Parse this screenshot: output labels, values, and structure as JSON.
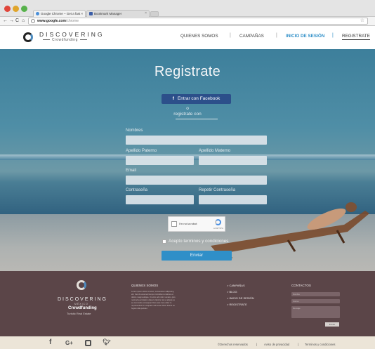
{
  "browser": {
    "tabs": [
      {
        "label": "Google Chrome – Get a fast  ×"
      },
      {
        "label": "Bookmark Manager"
      }
    ],
    "url_host": "www.google.com",
    "url_path": "/chrome"
  },
  "header": {
    "logo_title": "DISCOVERING",
    "logo_subtitle": "Crowdfunding",
    "nav": [
      {
        "label": "QUIENES SOMOS"
      },
      {
        "label": "CAMPAÑAS"
      },
      {
        "label": "INICIO DE SESIÓN"
      },
      {
        "label": "REGISTRATE"
      }
    ],
    "separator": "|"
  },
  "form": {
    "title": "Registrate",
    "facebook_label": "Entrar con Facebook",
    "facebook_glyph": "f",
    "or_text": "o",
    "register_with": "registrate con",
    "fields": {
      "nombres": "Nombres",
      "apellido_paterno": "Apellido Paterno",
      "apellido_materno": "Apellido Materno",
      "email": "Email",
      "contrasena": "Contraseña",
      "repetir_contrasena": "Repetir Contraseña"
    },
    "captcha_text": "I'm not a robot",
    "captcha_small": "reCAPTCHA",
    "terms": "Acepto terminos y condiciones",
    "submit": "Enviar"
  },
  "footer": {
    "logo_title": "DISCOVERING",
    "logo_country": "MÉXICO",
    "logo_crowd": "Crowdfunding",
    "logo_tag": "Turistic Real Estate",
    "quienes_heading": "QUIENES SOMOS",
    "quienes_text": "Lorem ipsum dolor sit amet, consectetur adipiscing elit. Sed do eiusmod tempor incididunt ut labore et dolore magna aliqua. Ut enim ad minim veniam, quis nostrud exercitation ullamco laboris nisi ut aliquip ex ea commodo consequat. Duis aute irure dolor in reprehenderit in voluptate velit esse cillum dolore eu fugiat nulla pariatur.",
    "links": [
      {
        "label": "CAMPAÑAS"
      },
      {
        "label": "BLOG"
      },
      {
        "label": "INICIO DE SESIÓN"
      },
      {
        "label": "REGISTRATE"
      }
    ],
    "link_arrow": ">",
    "contact_heading": "CONTACTOS",
    "contact_name_placeholder": "Nombre",
    "contact_email_placeholder": "Correo",
    "contact_message_placeholder": "Mensaje",
    "contact_send": "Enviar"
  },
  "bottom": {
    "rights": "©Derechos reservados",
    "privacy": "Aviso de privacidad",
    "terms": "Terminos y condiciones",
    "separator": "|",
    "social_icons": [
      "facebook-icon",
      "google-plus-icon",
      "instagram-icon",
      "twitter-icon"
    ]
  },
  "colors": {
    "accent": "#2f8fc8",
    "facebook": "#2c4f8a",
    "footer_bg": "#5b4548",
    "bottom_bg": "#ece5d8"
  }
}
